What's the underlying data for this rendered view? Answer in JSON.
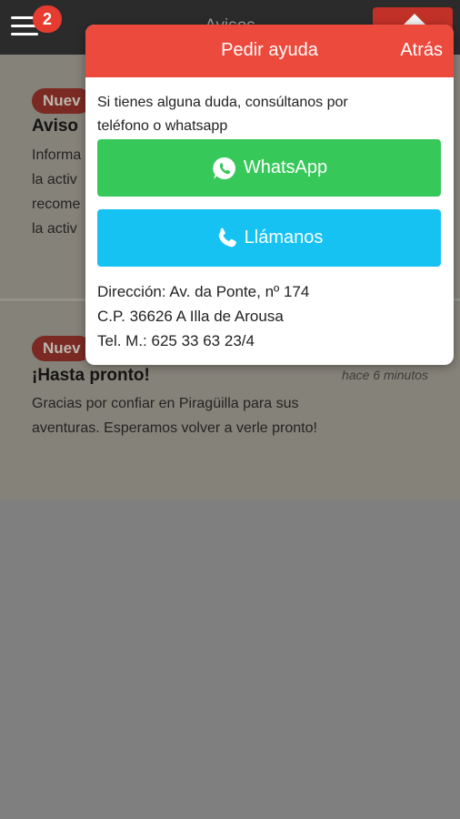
{
  "app": {
    "title": "Avisos",
    "notification_count": "2"
  },
  "notices": [
    {
      "badge": "Nuev",
      "title": "Aviso",
      "lines": [
        "Informa",
        "la activ",
        "recome",
        "la activ"
      ]
    },
    {
      "badge": "Nuev",
      "title": "¡Hasta pronto!",
      "time": "hace 6 minutos",
      "lines": [
        "Gracias por confiar en Piragüilla para sus",
        "aventuras. Esperamos volver a verle pronto!"
      ]
    }
  ],
  "help": {
    "title": "Pedir ayuda",
    "back_label": "Atrás",
    "intro_line1": "Si tienes alguna duda, consúltanos por",
    "intro_line2": "teléfono o whatsapp",
    "whatsapp_label": "WhatsApp",
    "call_label": "Llámanos",
    "address": "Dirección: Av. da Ponte, nº 174",
    "postal": "C.P. 36626 A Illa de Arousa",
    "phone": "Tel. M.: 625 33 63 23/4"
  },
  "colors": {
    "header_red": "#ec4a3c",
    "whatsapp_green": "#37c85a",
    "call_blue": "#15c2f2"
  },
  "icons": [
    "menu-icon",
    "whatsapp-icon",
    "phone-icon"
  ]
}
